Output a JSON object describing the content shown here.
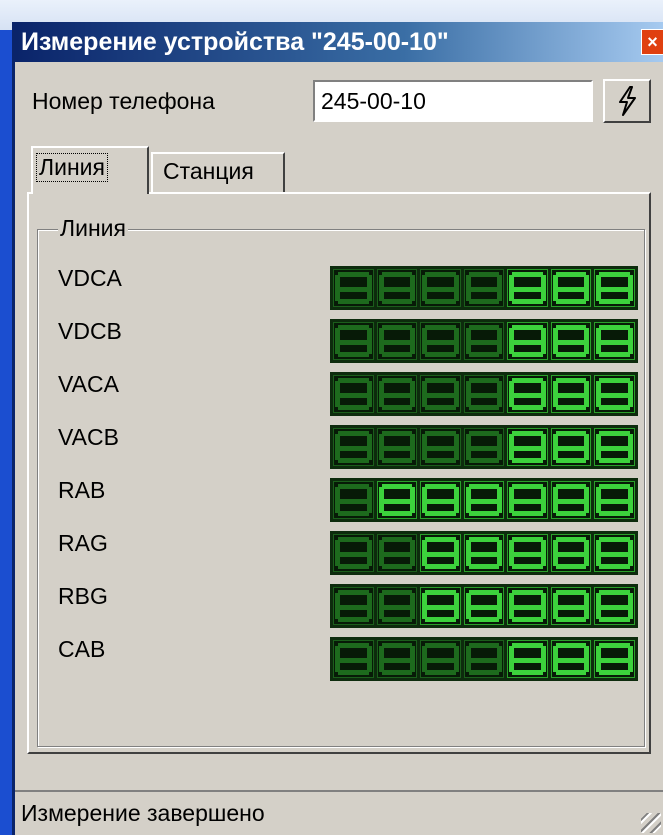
{
  "window": {
    "title": "Измерение устройства \"245-00-10\"",
    "close_label": "×"
  },
  "phone": {
    "label": "Номер телефона",
    "value": "245-00-10"
  },
  "run_button": {
    "icon": "lightning-icon"
  },
  "tabs": [
    {
      "label": "Линия",
      "active": true
    },
    {
      "label": "Станция",
      "active": false
    }
  ],
  "group": {
    "title": "Линия",
    "rows": [
      {
        "label": "VDCA",
        "digits_lit": [
          false,
          false,
          false,
          false,
          true,
          true,
          true
        ]
      },
      {
        "label": "VDCB",
        "digits_lit": [
          false,
          false,
          false,
          false,
          true,
          true,
          true
        ]
      },
      {
        "label": "VACA",
        "digits_lit": [
          false,
          false,
          false,
          false,
          true,
          true,
          true
        ]
      },
      {
        "label": "VACB",
        "digits_lit": [
          false,
          false,
          false,
          false,
          true,
          true,
          true
        ]
      },
      {
        "label": "RAB",
        "digits_lit": [
          false,
          true,
          true,
          true,
          true,
          true,
          true
        ]
      },
      {
        "label": "RAG",
        "digits_lit": [
          false,
          false,
          true,
          true,
          true,
          true,
          true
        ]
      },
      {
        "label": "RBG",
        "digits_lit": [
          false,
          false,
          true,
          true,
          true,
          true,
          true
        ]
      },
      {
        "label": "CAB",
        "digits_lit": [
          false,
          false,
          false,
          false,
          true,
          true,
          true
        ]
      }
    ]
  },
  "status": {
    "text": "Измерение завершено"
  },
  "colors": {
    "lcd_on": "#3cd23c",
    "lcd_off": "#1d6a1d",
    "title_bar": "#0a246a"
  }
}
